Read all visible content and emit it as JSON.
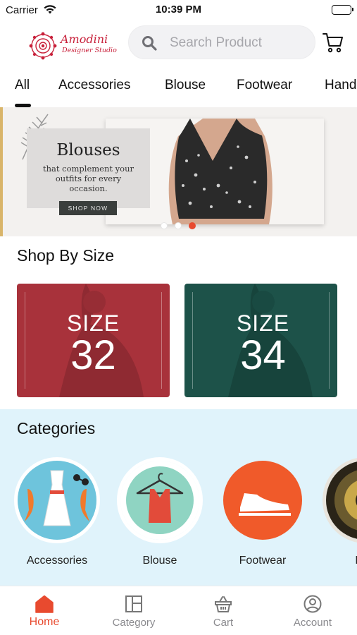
{
  "status_bar": {
    "carrier": "Carrier",
    "time": "10:39 PM"
  },
  "header": {
    "brand_name": "Amodini",
    "brand_tagline": "Designer Studio",
    "search_placeholder": "Search Product",
    "icons": [
      "search-icon",
      "cart-icon"
    ]
  },
  "tabs": {
    "items": [
      {
        "label": "All",
        "active": true
      },
      {
        "label": "Accessories",
        "active": false
      },
      {
        "label": "Blouse",
        "active": false
      },
      {
        "label": "Footwear",
        "active": false
      },
      {
        "label": "Hand",
        "active": false
      }
    ]
  },
  "banner": {
    "title": "Blouses",
    "subtitle": "that complement your outfits for every occasion.",
    "cta": "SHOP NOW",
    "slides": 3,
    "active_slide": 3
  },
  "shop_by_size": {
    "title": "Shop By Size",
    "cards": [
      {
        "word": "SIZE",
        "number": "32",
        "color": "#a8323b"
      },
      {
        "word": "SIZE",
        "number": "34",
        "color": "#1d5249"
      }
    ]
  },
  "categories": {
    "title": "Categories",
    "items": [
      {
        "label": "Accessories",
        "icon": "dress-accessories-icon"
      },
      {
        "label": "Blouse",
        "icon": "hanger-top-icon"
      },
      {
        "label": "Footwear",
        "icon": "shoe-icon"
      },
      {
        "label": "Han",
        "icon": "handbag-icon"
      }
    ]
  },
  "bottom_nav": {
    "items": [
      {
        "label": "Home",
        "icon": "home-icon",
        "active": true
      },
      {
        "label": "Category",
        "icon": "category-icon",
        "active": false
      },
      {
        "label": "Cart",
        "icon": "basket-icon",
        "active": false
      },
      {
        "label": "Account",
        "icon": "account-icon",
        "active": false
      }
    ]
  },
  "colors": {
    "accent": "#e84a2f",
    "brand": "#c8203a",
    "categories_bg": "#e0f3fb",
    "size_32": "#a8323b",
    "size_34": "#1d5249"
  }
}
